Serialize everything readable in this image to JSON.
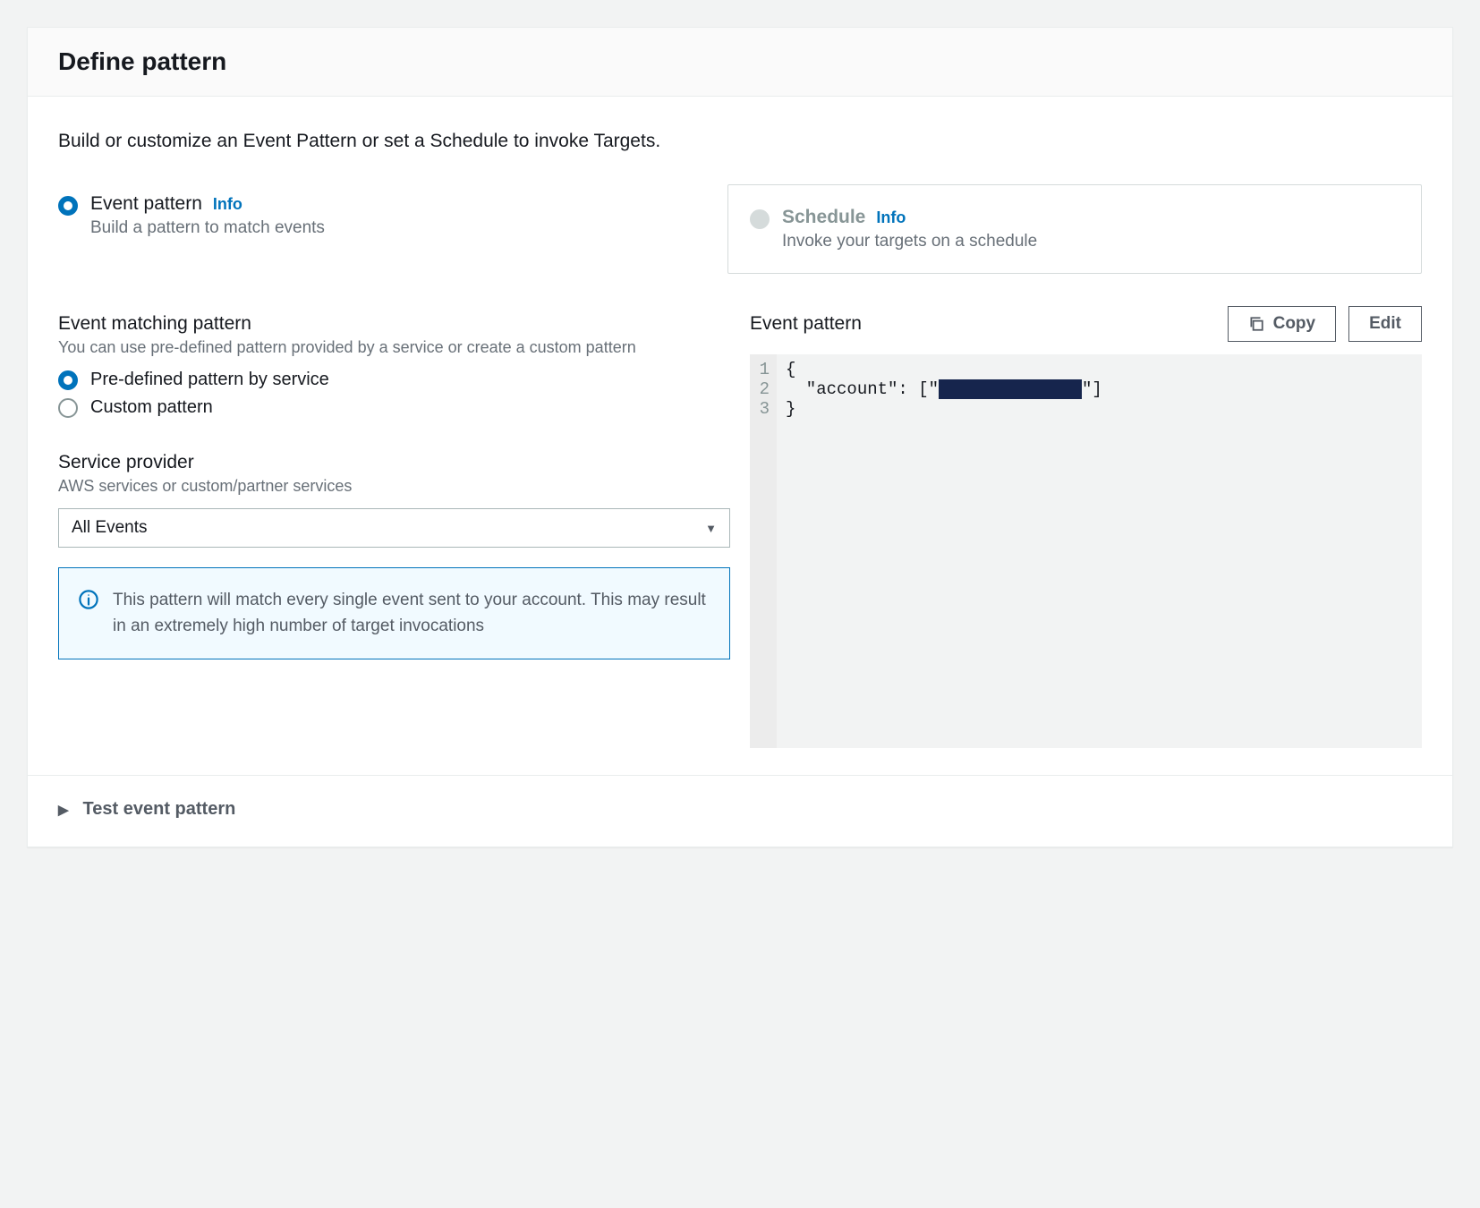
{
  "header": {
    "title": "Define pattern"
  },
  "intro": "Build or customize an Event Pattern or set a Schedule to invoke Targets.",
  "type": {
    "event": {
      "label": "Event pattern",
      "info": "Info",
      "desc": "Build a pattern to match events",
      "selected": true
    },
    "schedule": {
      "label": "Schedule",
      "info": "Info",
      "desc": "Invoke your targets on a schedule",
      "selected": false
    }
  },
  "matching": {
    "title": "Event matching pattern",
    "sub": "You can use pre-defined pattern provided by a service or create a custom pattern",
    "options": {
      "predefined": "Pre-defined pattern by service",
      "custom": "Custom pattern"
    }
  },
  "provider": {
    "title": "Service provider",
    "sub": "AWS services or custom/partner services",
    "selected": "All Events"
  },
  "alert": {
    "text": "This pattern will match every single event sent to your account. This may result in an extremely high number of target invocations"
  },
  "ep": {
    "title": "Event pattern",
    "copy": "Copy",
    "edit": "Edit",
    "lines": [
      "1",
      "2",
      "3"
    ],
    "l1": "{",
    "l2a": "  \"account\": [\"",
    "l2b": "\"]",
    "l3": "}"
  },
  "footer": {
    "test": "Test event pattern"
  }
}
